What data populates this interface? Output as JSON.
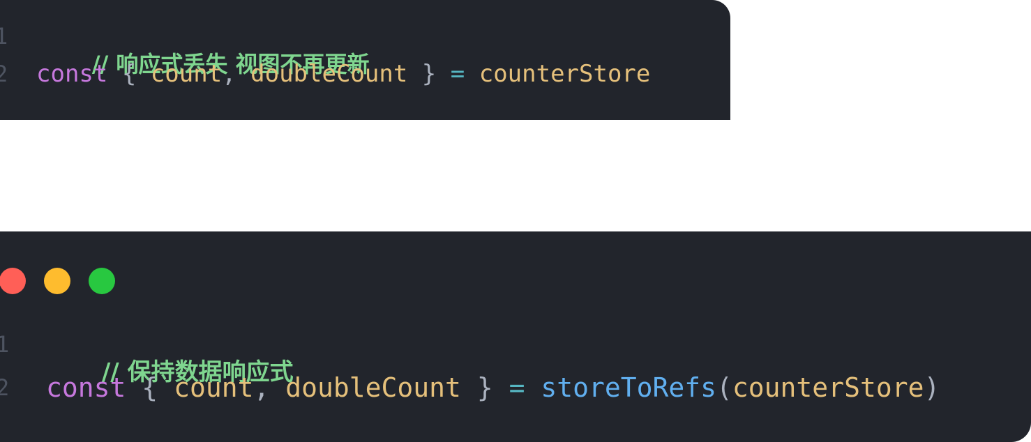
{
  "block1": {
    "line_numbers": [
      "1",
      "2"
    ],
    "comment": "// 响应式丢失 视图不再更新",
    "keyword": "const",
    "open_brace": "{",
    "var1": "count",
    "comma": ",",
    "var2": "doubleCount",
    "close_brace": "}",
    "equals": "=",
    "rhs": "counterStore"
  },
  "block2": {
    "window_dots": [
      "#ff5f57",
      "#febc2e",
      "#28c840"
    ],
    "line_numbers": [
      "1",
      "2"
    ],
    "comment": "// 保持数据响应式",
    "keyword": "const",
    "open_brace": "{",
    "var1": "count",
    "comma": ",",
    "var2": "doubleCount",
    "close_brace": "}",
    "equals": "=",
    "fn_name": "storeToRefs",
    "open_paren": "(",
    "arg": "counterStore",
    "close_paren": ")"
  }
}
